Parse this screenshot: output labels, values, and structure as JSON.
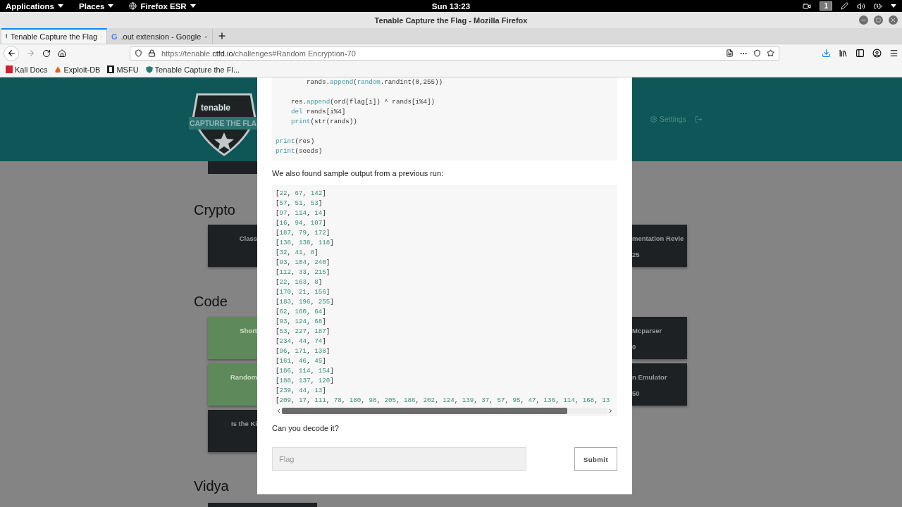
{
  "system_bar": {
    "menus": [
      {
        "label": "Applications",
        "kind": "plain"
      },
      {
        "label": "Places",
        "kind": "plain"
      },
      {
        "label": "Firefox ESR",
        "kind": "app"
      }
    ],
    "clock": "Sun 13:23",
    "workspace": "1"
  },
  "window": {
    "title": "Tenable Capture the Flag - Mozilla Firefox"
  },
  "tabs": [
    {
      "label": "Tenable Capture the Flag",
      "selected": true,
      "kind": "site"
    },
    {
      "label": ".out extension - Google",
      "selected": false,
      "kind": "google"
    }
  ],
  "google_mark": "G",
  "address": {
    "host_start": "https://tenable.",
    "domain": "ctfd.io",
    "path": "/challenges#Random Encryption-70"
  },
  "bookmarks": [
    {
      "label": "Kali Docs",
      "kind": "kali"
    },
    {
      "label": "Exploit-DB",
      "kind": "exploit"
    },
    {
      "label": "MSFU",
      "kind": "msfu"
    },
    {
      "label": "Tenable Capture the Fl...",
      "kind": "site"
    }
  ],
  "header": {
    "logo_top": "tenable",
    "logo_banner": "CAPTURE THE FLA",
    "settings": "Settings"
  },
  "background": [
    {
      "kind": "strip"
    },
    {
      "kind": "heading",
      "text": "Crypto"
    },
    {
      "kind": "row",
      "left": {
        "title": "Class",
        "solved": false
      },
      "right": {
        "title": "mentation Revie",
        "points": "25"
      }
    },
    {
      "kind": "heading",
      "text": "Code"
    },
    {
      "kind": "row",
      "left": {
        "title": "Short",
        "solved": true
      },
      "right": {
        "title": "Mcparser",
        "points": "0"
      }
    },
    {
      "kind": "row",
      "left": {
        "title": "Random",
        "solved": true
      },
      "right": {
        "title": "n Emulator",
        "points": "50"
      }
    },
    {
      "kind": "row",
      "left": {
        "title": "Is the Ki",
        "solved": false
      }
    },
    {
      "kind": "heading",
      "text": "Vidya"
    },
    {
      "kind": "wide"
    }
  ],
  "modal": {
    "code": [
      {
        "kind": "nested",
        "tokens": [
          {
            "text": "rands.",
            "kind": "plain"
          },
          {
            "text": "append",
            "kind": "keyword"
          },
          {
            "text": "(",
            "kind": "plain"
          },
          {
            "text": "random",
            "kind": "keyword"
          },
          {
            "text": ".randint(0,255))",
            "kind": "plain"
          }
        ]
      },
      {
        "kind": "blank"
      },
      {
        "kind": "body",
        "tokens": [
          {
            "text": "res.",
            "kind": "plain"
          },
          {
            "text": "append",
            "kind": "keyword"
          },
          {
            "text": "(ord(flag[i]) ^ rands[i%4])",
            "kind": "plain"
          }
        ]
      },
      {
        "kind": "body",
        "tokens": [
          {
            "text": "del",
            "kind": "keyword"
          },
          {
            "text": " rands[i%4]",
            "kind": "plain"
          }
        ]
      },
      {
        "kind": "body",
        "tokens": [
          {
            "text": "print",
            "kind": "keyword"
          },
          {
            "text": "(str(rands))",
            "kind": "plain"
          }
        ]
      },
      {
        "kind": "blank"
      },
      {
        "kind": "top",
        "tokens": [
          {
            "text": "print",
            "kind": "keyword"
          },
          {
            "text": "(res)",
            "kind": "plain"
          }
        ]
      },
      {
        "kind": "top",
        "tokens": [
          {
            "text": "print",
            "kind": "keyword"
          },
          {
            "text": "(seeds)",
            "kind": "plain"
          }
        ]
      }
    ],
    "intro": "We also found sample output from a previous run:",
    "output": [
      "[22, 67, 142]",
      "[57, 51, 53]",
      "[97, 114, 14]",
      "[16, 94, 107]",
      "[187, 79, 172]",
      "[138, 138, 118]",
      "[32, 41, 8]",
      "[93, 104, 240]",
      "[112, 33, 215]",
      "[22, 163, 8]",
      "[170, 21, 156]",
      "[183, 196, 255]",
      "[62, 160, 64]",
      "[93, 124, 68]",
      "[53, 227, 187]",
      "[234, 44, 74]",
      "[96, 171, 138]",
      "[161, 46, 45]",
      "[186, 114, 154]",
      "[188, 137, 120]",
      "[239, 44, 13]",
      "[209, 17, 111, 78, 180, 98, 205, 186, 202, 124, 139, 37, 57, 95, 47, 136, 114, 168, 13"
    ],
    "question": "Can you decode it?",
    "flag_field": {
      "placeholder": "Flag"
    },
    "submit": "Submit"
  }
}
